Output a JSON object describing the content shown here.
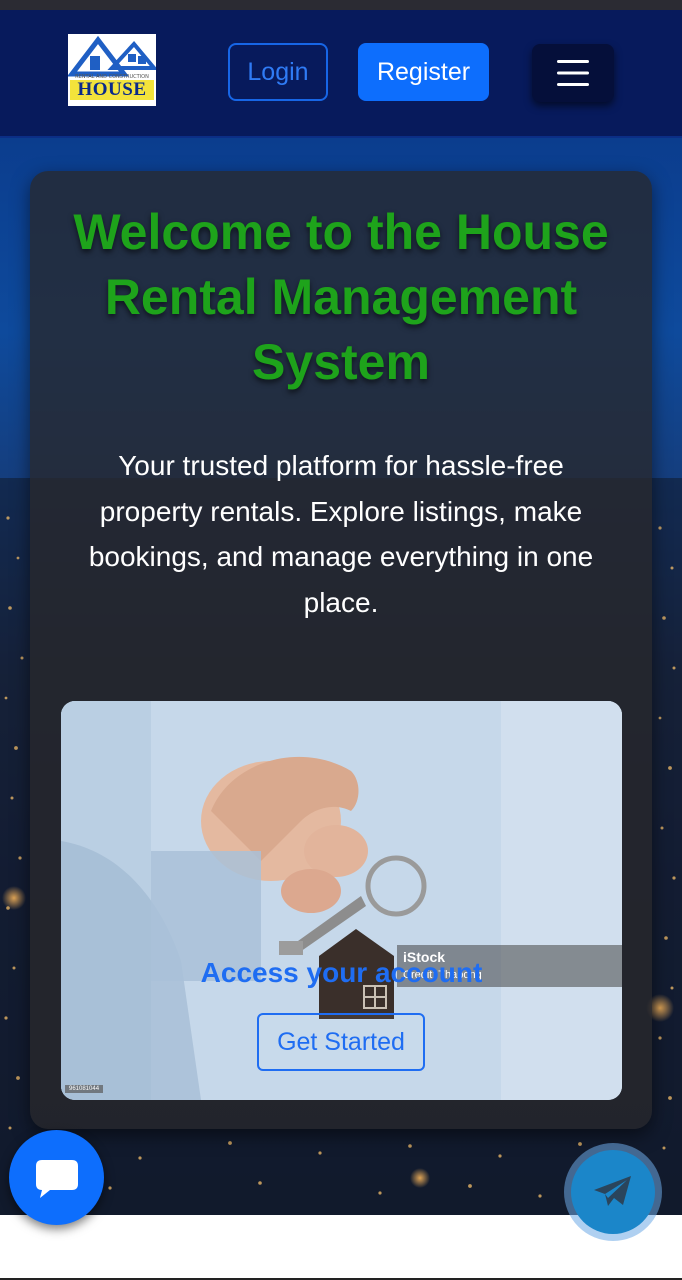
{
  "header": {
    "logo_word": "HOUSE",
    "logo_tagline": "RENTAL AND CONSTRUCTION",
    "login_label": "Login",
    "register_label": "Register",
    "menu_icon": "hamburger-icon"
  },
  "hero": {
    "title": "Welcome to the House Rental Management System",
    "description": "Your trusted platform for hassle-free property rentals. Explore listings, make bookings, and manage everything in one place."
  },
  "access": {
    "title": "Access your account",
    "button_label": "Get Started",
    "watermark_brand": "iStock",
    "watermark_credit": "Credit: Thapong",
    "photo_id": "961081044"
  },
  "floating": {
    "chat_icon": "chat-bubble-icon",
    "telegram_icon": "telegram-icon"
  },
  "colors": {
    "navbar": "#071a5c",
    "primary": "#0d6efd",
    "title_green": "#1ea31b",
    "card": "#28282c"
  }
}
